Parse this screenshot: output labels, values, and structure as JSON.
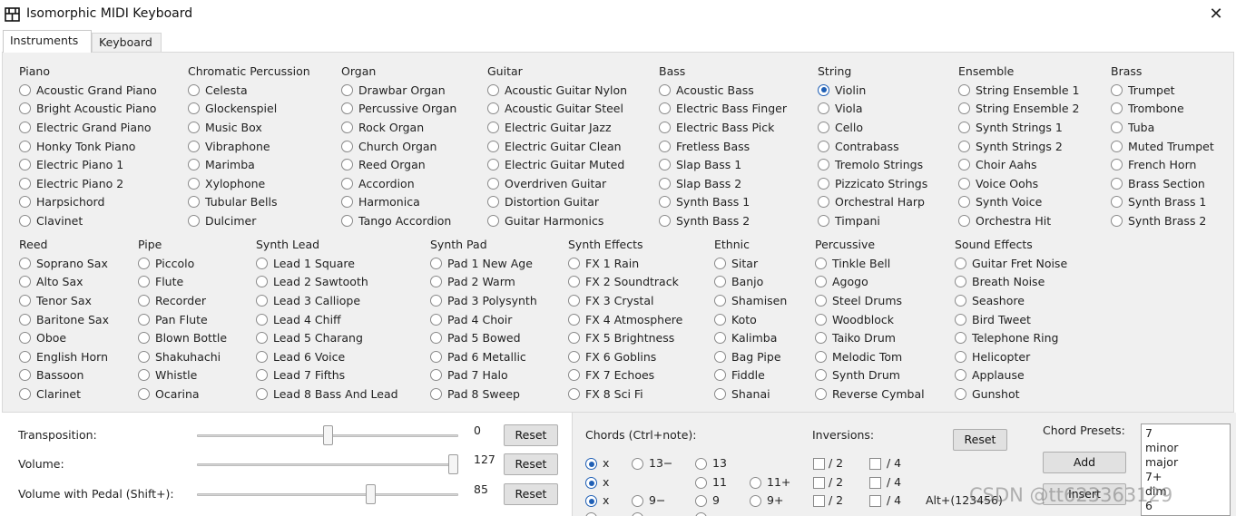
{
  "window": {
    "title": "Isomorphic MIDI Keyboard",
    "close_glyph": "✕"
  },
  "tabs": [
    {
      "label": "Instruments"
    },
    {
      "label": "Keyboard"
    }
  ],
  "groups": [
    {
      "title": "Piano",
      "items": [
        "Acoustic Grand Piano",
        "Bright Acoustic Piano",
        "Electric Grand Piano",
        "Honky Tonk Piano",
        "Electric Piano 1",
        "Electric Piano 2",
        "Harpsichord",
        "Clavinet"
      ]
    },
    {
      "title": "Chromatic Percussion",
      "items": [
        "Celesta",
        "Glockenspiel",
        "Music Box",
        "Vibraphone",
        "Marimba",
        "Xylophone",
        "Tubular Bells",
        "Dulcimer"
      ]
    },
    {
      "title": "Organ",
      "items": [
        "Drawbar Organ",
        "Percussive Organ",
        "Rock Organ",
        "Church Organ",
        "Reed Organ",
        "Accordion",
        "Harmonica",
        "Tango Accordion"
      ]
    },
    {
      "title": "Guitar",
      "items": [
        "Acoustic Guitar Nylon",
        "Acoustic Guitar Steel",
        "Electric Guitar Jazz",
        "Electric Guitar Clean",
        "Electric Guitar Muted",
        "Overdriven Guitar",
        "Distortion Guitar",
        "Guitar Harmonics"
      ]
    },
    {
      "title": "Bass",
      "items": [
        "Acoustic Bass",
        "Electric Bass Finger",
        "Electric Bass Pick",
        "Fretless Bass",
        "Slap Bass 1",
        "Slap Bass 2",
        "Synth Bass 1",
        "Synth Bass 2"
      ]
    },
    {
      "title": "String",
      "items": [
        "Violin",
        "Viola",
        "Cello",
        "Contrabass",
        "Tremolo Strings",
        "Pizzicato Strings",
        "Orchestral Harp",
        "Timpani"
      ]
    },
    {
      "title": "Ensemble",
      "items": [
        "String Ensemble 1",
        "String Ensemble 2",
        "Synth Strings 1",
        "Synth Strings 2",
        "Choir Aahs",
        "Voice Oohs",
        "Synth Voice",
        "Orchestra Hit"
      ]
    },
    {
      "title": "Brass",
      "items": [
        "Trumpet",
        "Trombone",
        "Tuba",
        "Muted Trumpet",
        "French Horn",
        "Brass Section",
        "Synth Brass 1",
        "Synth Brass 2"
      ]
    },
    {
      "title": "Reed",
      "items": [
        "Soprano Sax",
        "Alto Sax",
        "Tenor Sax",
        "Baritone Sax",
        "Oboe",
        "English Horn",
        "Bassoon",
        "Clarinet"
      ]
    },
    {
      "title": "Pipe",
      "items": [
        "Piccolo",
        "Flute",
        "Recorder",
        "Pan Flute",
        "Blown Bottle",
        "Shakuhachi",
        "Whistle",
        "Ocarina"
      ]
    },
    {
      "title": "Synth Lead",
      "items": [
        "Lead 1 Square",
        "Lead 2 Sawtooth",
        "Lead 3 Calliope",
        "Lead 4 Chiff",
        "Lead 5 Charang",
        "Lead 6 Voice",
        "Lead 7 Fifths",
        "Lead 8 Bass And Lead"
      ]
    },
    {
      "title": "Synth Pad",
      "items": [
        "Pad 1 New Age",
        "Pad 2 Warm",
        "Pad 3 Polysynth",
        "Pad 4 Choir",
        "Pad 5 Bowed",
        "Pad 6 Metallic",
        "Pad 7 Halo",
        "Pad 8 Sweep"
      ]
    },
    {
      "title": "Synth Effects",
      "items": [
        "FX 1 Rain",
        "FX 2 Soundtrack",
        "FX 3 Crystal",
        "FX 4 Atmosphere",
        "FX 5 Brightness",
        "FX 6 Goblins",
        "FX 7 Echoes",
        "FX 8 Sci Fi"
      ]
    },
    {
      "title": "Ethnic",
      "items": [
        "Sitar",
        "Banjo",
        "Shamisen",
        "Koto",
        "Kalimba",
        "Bag Pipe",
        "Fiddle",
        "Shanai"
      ]
    },
    {
      "title": "Percussive",
      "items": [
        "Tinkle Bell",
        "Agogo",
        "Steel Drums",
        "Woodblock",
        "Taiko Drum",
        "Melodic Tom",
        "Synth Drum",
        "Reverse Cymbal"
      ]
    },
    {
      "title": "Sound Effects",
      "items": [
        "Guitar Fret Noise",
        "Breath Noise",
        "Seashore",
        "Bird Tweet",
        "Telephone Ring",
        "Helicopter",
        "Applause",
        "Gunshot"
      ]
    }
  ],
  "selected_instrument": "Violin",
  "controls": {
    "transposition": {
      "label": "Transposition:",
      "value": "0",
      "fraction": 0.5,
      "reset": "Reset"
    },
    "volume": {
      "label": "Volume:",
      "value": "127",
      "fraction": 1.0,
      "reset": "Reset"
    },
    "volume_pedal": {
      "label": "Volume with Pedal (Shift+):",
      "value": "85",
      "fraction": 0.67,
      "reset": "Reset"
    }
  },
  "chords": {
    "title": "Chords (Ctrl+note):",
    "row1": [
      "x",
      "13−",
      "13"
    ],
    "row2": [
      "x",
      "11",
      "11+"
    ],
    "row3": [
      "x",
      "9−",
      "9",
      "9+"
    ]
  },
  "inversions": {
    "title": "Inversions:",
    "labels": [
      "/ 2",
      "/ 4",
      "/ 2",
      "/ 4",
      "/ 2",
      "/ 4"
    ],
    "alt_hint": "Alt+(123456)",
    "reset": "Reset"
  },
  "chord_presets": {
    "title": "Chord Presets:",
    "add": "Add",
    "insert": "Insert",
    "list": [
      "7",
      "minor",
      "major",
      "7+",
      "dim",
      "6"
    ]
  },
  "watermark": "CSDN @tt623363129"
}
